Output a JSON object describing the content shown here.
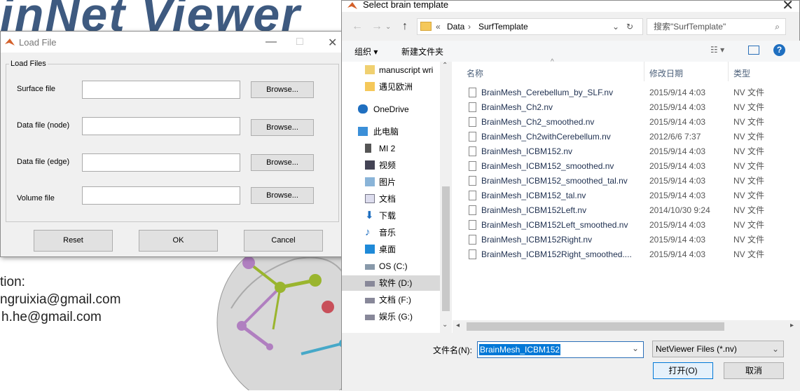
{
  "background": {
    "title": "inNet Viewer",
    "info_lines": [
      "tion:",
      "ngruixia@gmail.com",
      "h.he@gmail.com"
    ]
  },
  "load_dialog": {
    "title": "Load File",
    "group": "Load Files",
    "rows": [
      {
        "label": "Surface file",
        "button": "Browse..."
      },
      {
        "label": "Data file (node)",
        "button": "Browse..."
      },
      {
        "label": "Data file (edge)",
        "button": "Browse..."
      },
      {
        "label": "Volume file",
        "button": "Browse..."
      }
    ],
    "reset": "Reset",
    "ok": "OK",
    "cancel": "Cancel"
  },
  "select_dialog": {
    "title": "Select brain template",
    "breadcrumb": [
      "«",
      "Data",
      "›",
      "SurfTemplate"
    ],
    "search_placeholder": "搜索\"SurfTemplate\"",
    "organize": "组织 ▾",
    "new_folder": "新建文件夹",
    "nav": [
      {
        "label": "manuscript wri",
        "icon": "document-icon"
      },
      {
        "label": "遇见欧洲",
        "icon": "folder-icon"
      },
      {
        "label": "OneDrive",
        "icon": "cloud-icon"
      },
      {
        "label": "此电脑",
        "icon": "computer-icon"
      },
      {
        "label": "MI 2",
        "icon": "phone-icon"
      },
      {
        "label": "视频",
        "icon": "video-icon"
      },
      {
        "label": "图片",
        "icon": "picture-icon"
      },
      {
        "label": "文档",
        "icon": "document-icon"
      },
      {
        "label": "下载",
        "icon": "download-icon"
      },
      {
        "label": "音乐",
        "icon": "music-icon"
      },
      {
        "label": "桌面",
        "icon": "desktop-icon"
      },
      {
        "label": "OS (C:)",
        "icon": "drive-icon"
      },
      {
        "label": "软件 (D:)",
        "icon": "drive-icon",
        "selected": true
      },
      {
        "label": "文档 (F:)",
        "icon": "drive-icon"
      },
      {
        "label": "娱乐 (G:)",
        "icon": "drive-icon"
      }
    ],
    "columns": {
      "name": "名称",
      "date": "修改日期",
      "type": "类型"
    },
    "files": [
      {
        "name": "BrainMesh_Cerebellum_by_SLF.nv",
        "date": "2015/9/14 4:03",
        "type": "NV 文件"
      },
      {
        "name": "BrainMesh_Ch2.nv",
        "date": "2015/9/14 4:03",
        "type": "NV 文件"
      },
      {
        "name": "BrainMesh_Ch2_smoothed.nv",
        "date": "2015/9/14 4:03",
        "type": "NV 文件"
      },
      {
        "name": "BrainMesh_Ch2withCerebellum.nv",
        "date": "2012/6/6 7:37",
        "type": "NV 文件"
      },
      {
        "name": "BrainMesh_ICBM152.nv",
        "date": "2015/9/14 4:03",
        "type": "NV 文件"
      },
      {
        "name": "BrainMesh_ICBM152_smoothed.nv",
        "date": "2015/9/14 4:03",
        "type": "NV 文件"
      },
      {
        "name": "BrainMesh_ICBM152_smoothed_tal.nv",
        "date": "2015/9/14 4:03",
        "type": "NV 文件"
      },
      {
        "name": "BrainMesh_ICBM152_tal.nv",
        "date": "2015/9/14 4:03",
        "type": "NV 文件"
      },
      {
        "name": "BrainMesh_ICBM152Left.nv",
        "date": "2014/10/30 9:24",
        "type": "NV 文件"
      },
      {
        "name": "BrainMesh_ICBM152Left_smoothed.nv",
        "date": "2015/9/14 4:03",
        "type": "NV 文件"
      },
      {
        "name": "BrainMesh_ICBM152Right.nv",
        "date": "2015/9/14 4:03",
        "type": "NV 文件"
      },
      {
        "name": "BrainMesh_ICBM152Right_smoothed....",
        "date": "2015/9/14 4:03",
        "type": "NV 文件"
      }
    ],
    "filename_label": "文件名(N):",
    "filename_value": "BrainMesh_ICBM152",
    "filter_value": "NetViewer Files (*.nv)",
    "open": "打开(O)",
    "cancel": "取消"
  }
}
